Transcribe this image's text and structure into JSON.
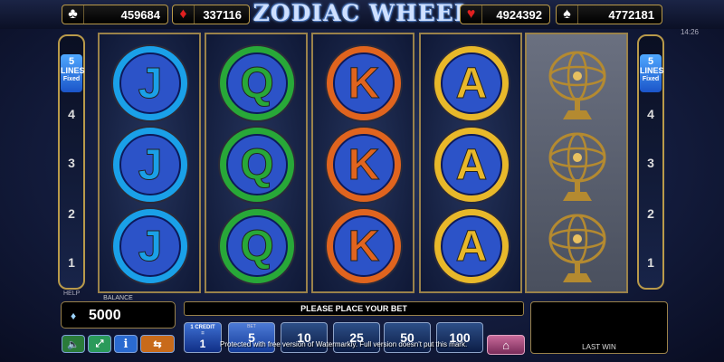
{
  "jackpots": [
    {
      "suit": "♣",
      "value": "459684"
    },
    {
      "suit": "♦",
      "value": "337116"
    },
    {
      "suit": "♥",
      "value": "4924392"
    },
    {
      "suit": "♠",
      "value": "4772181"
    }
  ],
  "logo": "ZODIAC WHEEL",
  "clock": "14:26",
  "lines": {
    "count": "5",
    "label": "LINES",
    "sub": "Fixed"
  },
  "line_numbers": [
    "4",
    "3",
    "2",
    "1"
  ],
  "help_label": "HELP",
  "balance": {
    "label": "BALANCE",
    "value": "5000"
  },
  "message": "PLEASE PLACE YOUR BET",
  "credit": {
    "value": "1",
    "label_top": "1 CREDIT",
    "label_bottom": "="
  },
  "bet_label": "BET",
  "bets": [
    "5",
    "10",
    "25",
    "50",
    "100"
  ],
  "selected_bet": "5",
  "last_win_label": "LAST WIN",
  "watermark": "Protected with free version of Watermarkly. Full version doesn't put this mark.",
  "reels": [
    {
      "symbol": "J",
      "color": "#1aa0e8"
    },
    {
      "symbol": "Q",
      "color": "#28a838"
    },
    {
      "symbol": "K",
      "color": "#e0641e"
    },
    {
      "symbol": "A",
      "color": "#e8b82a"
    },
    {
      "symbol": "armillary-sphere",
      "color": "#b48a30"
    }
  ]
}
